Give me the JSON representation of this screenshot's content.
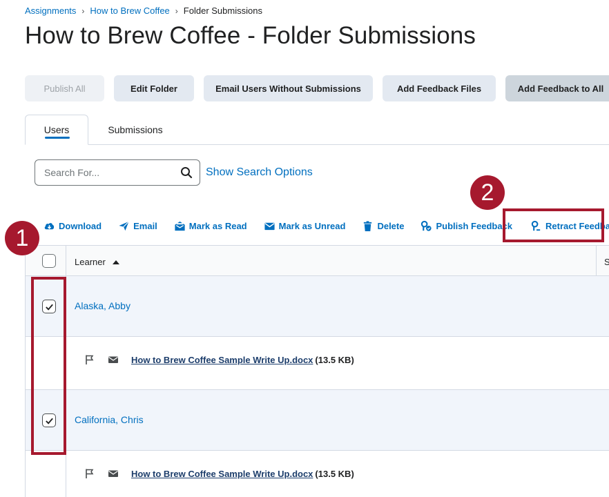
{
  "breadcrumb": {
    "item1": "Assignments",
    "item2": "How to Brew Coffee",
    "current": "Folder Submissions"
  },
  "page": {
    "title": "How to Brew Coffee - Folder Submissions"
  },
  "buttons": {
    "publish_all": "Publish All",
    "edit_folder": "Edit Folder",
    "email_users": "Email Users Without Submissions",
    "add_feedback_files": "Add Feedback Files",
    "add_feedback_all": "Add Feedback to All"
  },
  "tabs": {
    "users": "Users",
    "submissions": "Submissions"
  },
  "search": {
    "placeholder": "Search For...",
    "options_link": "Show Search Options"
  },
  "actions": {
    "download": "Download",
    "email": "Email",
    "mark_read": "Mark as Read",
    "mark_unread": "Mark as Unread",
    "delete": "Delete",
    "publish_feedback": "Publish Feedback",
    "retract_feedback": "Retract Feedback"
  },
  "callouts": {
    "one": "1",
    "two": "2"
  },
  "table": {
    "learner_header": "Learner",
    "next_header_partial": "S",
    "rows": [
      {
        "learner": "Alaska, Abby",
        "checked": true,
        "file_name": "How to Brew Coffee Sample Write Up.docx",
        "file_size": "(13.5 KB)"
      },
      {
        "learner": "California, Chris",
        "checked": true,
        "file_name": "How to Brew Coffee Sample Write Up.docx",
        "file_size": "(13.5 KB)"
      }
    ]
  },
  "colors": {
    "link": "#006fbf",
    "callout": "#a6192e",
    "button_bg": "#e3e9f1",
    "row_highlight": "#f1f5fb"
  }
}
